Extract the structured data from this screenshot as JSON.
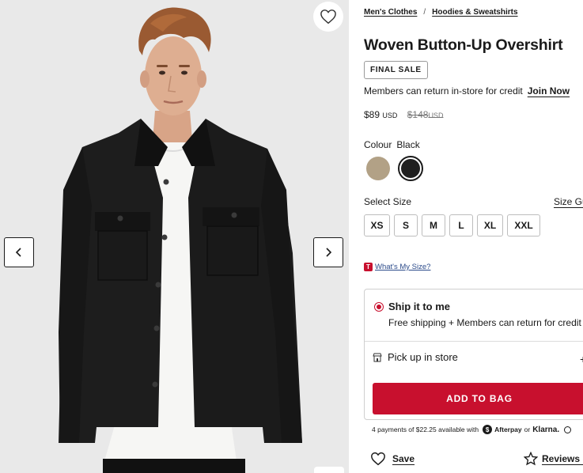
{
  "breadcrumb": {
    "items": [
      "Men's Clothes",
      "Hoodies & Sweatshirts"
    ],
    "separator": "/"
  },
  "product": {
    "title": "Woven Button-Up Overshirt",
    "badge": "FINAL SALE",
    "members_text": "Members can return in-store for credit",
    "join_link": "Join Now",
    "price": "$89",
    "price_currency": "USD",
    "original_price": "$148",
    "original_currency": "USD"
  },
  "colour": {
    "label": "Colour",
    "selected": "Black",
    "swatches": [
      {
        "name": "khaki",
        "hex": "#b2a186"
      },
      {
        "name": "black",
        "hex": "#1f1f1f"
      }
    ]
  },
  "size": {
    "label": "Select Size",
    "guide_link": "Size Guide",
    "options": [
      "XS",
      "S",
      "M",
      "L",
      "XL",
      "XXL"
    ],
    "fit_link": "What's My Size?",
    "fit_icon": "T"
  },
  "shipping": {
    "ship_title": "Ship it to me",
    "ship_sub": "Free shipping + Members can return for credit",
    "pickup_label": "Pick up in store",
    "pickup_toggle": "+"
  },
  "cart": {
    "add_label": "ADD TO BAG"
  },
  "payments": {
    "text": "4 payments of $22.25 available with",
    "afterpay_icon": "$",
    "afterpay": "Afterpay",
    "or": "or",
    "klarna": "Klarna."
  },
  "actions": {
    "save": "Save",
    "reviews": "Reviews ("
  },
  "colors": {
    "accent": "#c8102e",
    "image_bg": "#e9e9e9"
  }
}
